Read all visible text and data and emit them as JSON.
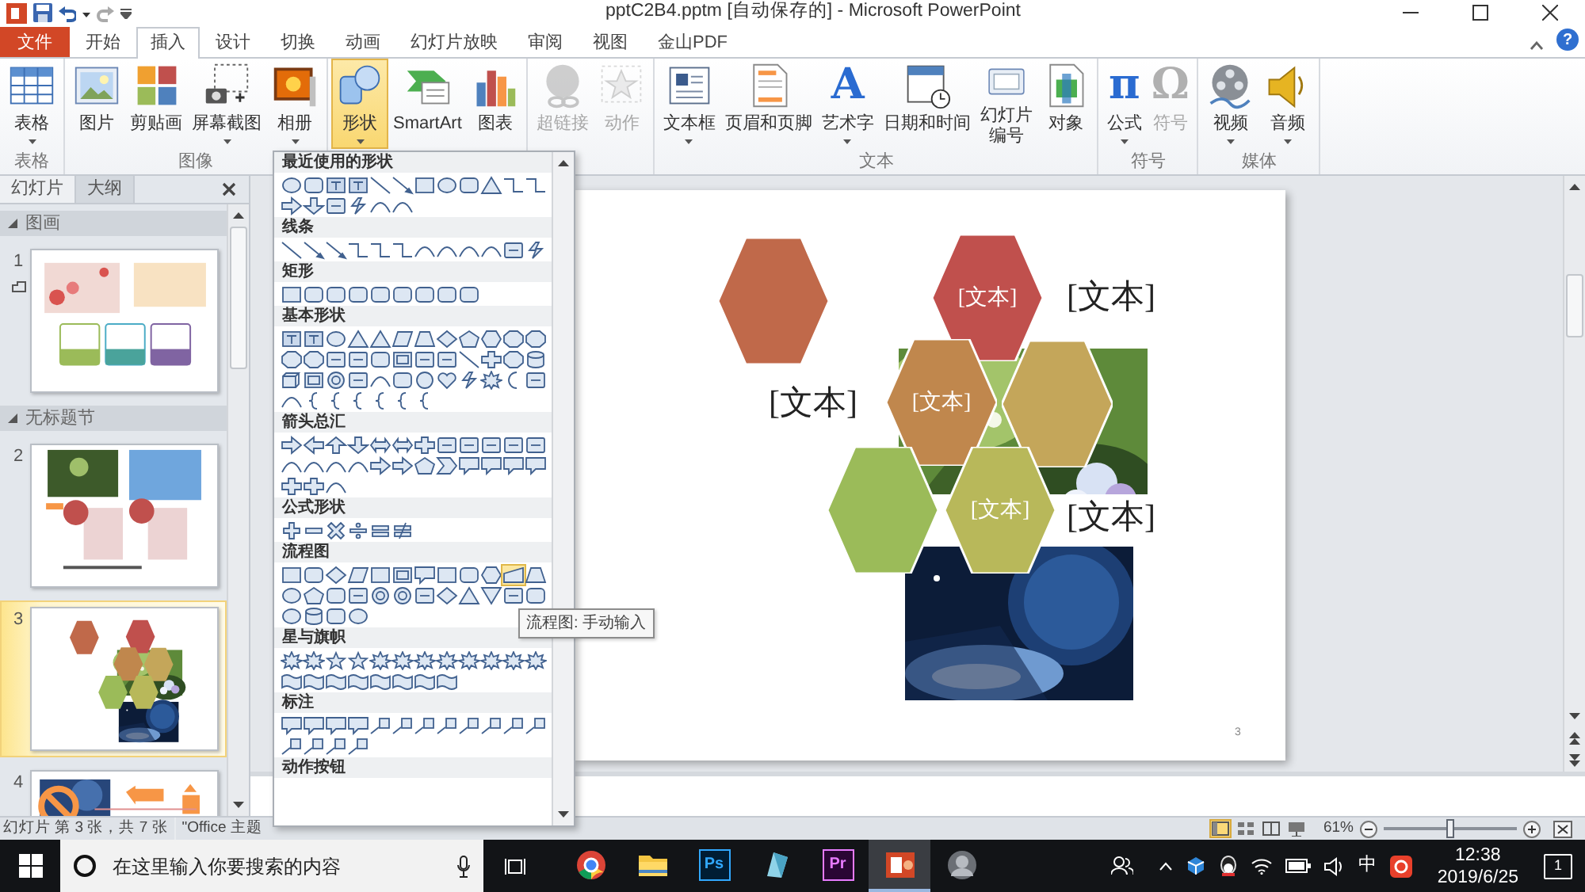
{
  "window": {
    "title": "pptC2B4.pptm [自动保存的] - Microsoft PowerPoint"
  },
  "ribbon_tabs": [
    {
      "label": "文件",
      "kind": "file",
      "selected": false
    },
    {
      "label": "开始",
      "kind": "tab",
      "selected": false
    },
    {
      "label": "插入",
      "kind": "tab",
      "selected": true
    },
    {
      "label": "设计",
      "kind": "tab",
      "selected": false
    },
    {
      "label": "切换",
      "kind": "tab",
      "selected": false
    },
    {
      "label": "动画",
      "kind": "tab",
      "selected": false
    },
    {
      "label": "幻灯片放映",
      "kind": "tab",
      "selected": false
    },
    {
      "label": "审阅",
      "kind": "tab",
      "selected": false
    },
    {
      "label": "视图",
      "kind": "tab",
      "selected": false
    },
    {
      "label": "金山PDF",
      "kind": "tab",
      "selected": false
    }
  ],
  "help": "?",
  "ribbon_groups": [
    {
      "label": "表格",
      "buttons": [
        {
          "label": "表格",
          "kind": "table",
          "dropdown": true,
          "disabled": false,
          "selected": false
        }
      ]
    },
    {
      "label": "图像",
      "buttons": [
        {
          "label": "图片",
          "kind": "picture",
          "dropdown": false,
          "disabled": false,
          "selected": false
        },
        {
          "label": "剪贴画",
          "kind": "clipart",
          "dropdown": false,
          "disabled": false,
          "selected": false
        },
        {
          "label": "屏幕截图",
          "kind": "screenshot",
          "dropdown": true,
          "disabled": false,
          "selected": false
        },
        {
          "label": "相册",
          "kind": "album",
          "dropdown": true,
          "disabled": false,
          "selected": false
        }
      ]
    },
    {
      "buttons": [
        {
          "label": "形状",
          "kind": "shapes",
          "dropdown": true,
          "disabled": false,
          "selected": true
        },
        {
          "label": "SmartArt",
          "kind": "smartart",
          "dropdown": false,
          "disabled": false,
          "selected": false
        },
        {
          "label": "图表",
          "kind": "chart",
          "dropdown": false,
          "disabled": false,
          "selected": false
        }
      ]
    },
    {
      "buttons": [
        {
          "label": "超链接",
          "kind": "hyperlink",
          "dropdown": false,
          "disabled": true,
          "selected": false
        },
        {
          "label": "动作",
          "kind": "action",
          "dropdown": false,
          "disabled": true,
          "selected": false
        }
      ]
    },
    {
      "label": "文本",
      "buttons": [
        {
          "label": "文本框",
          "kind": "textbox",
          "dropdown": true,
          "disabled": false,
          "selected": false
        },
        {
          "label": "页眉和页脚",
          "kind": "headerfooter",
          "dropdown": false,
          "disabled": false,
          "selected": false
        },
        {
          "label": "艺术字",
          "kind": "wordart",
          "glyph": "A",
          "dropdown": true,
          "disabled": false,
          "selected": false
        },
        {
          "label": "日期和时间",
          "kind": "datetime",
          "dropdown": false,
          "disabled": false,
          "selected": false
        },
        {
          "label": "幻灯片",
          "label_2": "编号",
          "kind": "slidenumber",
          "dropdown": false,
          "disabled": false,
          "selected": false
        },
        {
          "label": "对象",
          "kind": "object",
          "dropdown": false,
          "disabled": false,
          "selected": false
        }
      ]
    },
    {
      "label": "符号",
      "buttons": [
        {
          "label": "公式",
          "kind": "equation",
          "glyph": "π",
          "dropdown": true,
          "disabled": false,
          "selected": false
        },
        {
          "label": "符号",
          "kind": "symbol",
          "glyph": "Ω",
          "dropdown": false,
          "disabled": true,
          "selected": false
        }
      ]
    },
    {
      "label": "媒体",
      "buttons": [
        {
          "label": "视频",
          "kind": "video",
          "dropdown": true,
          "disabled": false,
          "selected": false
        },
        {
          "label": "音频",
          "kind": "audio",
          "dropdown": true,
          "disabled": false,
          "selected": false
        }
      ]
    }
  ],
  "shape_gallery": {
    "categories": [
      {
        "title": "最近使用的形状",
        "shapes": [
          {
            "kind": "oval"
          },
          {
            "kind": "rrect"
          },
          {
            "kind": "textbox"
          },
          {
            "kind": "textbox"
          },
          {
            "kind": "line"
          },
          {
            "kind": "arrowline"
          },
          {
            "kind": "rect"
          },
          {
            "kind": "oval"
          },
          {
            "kind": "rrect"
          },
          {
            "kind": "tri"
          },
          {
            "kind": "elbow"
          },
          {
            "kind": "elbow"
          },
          {
            "kind": "arrow"
          },
          {
            "kind": "arrowdown"
          },
          {
            "kind": "misc"
          },
          {
            "kind": "bolt"
          },
          {
            "kind": "curve"
          },
          {
            "kind": "curve"
          }
        ]
      },
      {
        "title": "线条",
        "shapes": [
          {
            "kind": "line"
          },
          {
            "kind": "arrowline"
          },
          {
            "kind": "arrowline"
          },
          {
            "kind": "elbow"
          },
          {
            "kind": "elbow"
          },
          {
            "kind": "elbow"
          },
          {
            "kind": "curve"
          },
          {
            "kind": "curve"
          },
          {
            "kind": "curve"
          },
          {
            "kind": "curve"
          },
          {
            "kind": "misc"
          },
          {
            "kind": "bolt"
          }
        ]
      },
      {
        "title": "矩形",
        "shapes": [
          {
            "kind": "rect"
          },
          {
            "kind": "rrect"
          },
          {
            "kind": "rrect"
          },
          {
            "kind": "rrect"
          },
          {
            "kind": "rrect"
          },
          {
            "kind": "rrect"
          },
          {
            "kind": "rrect"
          },
          {
            "kind": "rrect"
          },
          {
            "kind": "rrect"
          }
        ]
      },
      {
        "title": "基本形状",
        "shapes": [
          {
            "kind": "textbox"
          },
          {
            "kind": "textbox"
          },
          {
            "kind": "oval"
          },
          {
            "kind": "tri"
          },
          {
            "kind": "tri"
          },
          {
            "kind": "para"
          },
          {
            "kind": "trap"
          },
          {
            "kind": "diamond"
          },
          {
            "kind": "pent"
          },
          {
            "kind": "hex"
          },
          {
            "kind": "oct"
          },
          {
            "kind": "oct"
          },
          {
            "kind": "oct"
          },
          {
            "kind": "oct"
          },
          {
            "kind": "misc"
          },
          {
            "kind": "misc"
          },
          {
            "kind": "rrect"
          },
          {
            "kind": "frame"
          },
          {
            "kind": "misc"
          },
          {
            "kind": "misc"
          },
          {
            "kind": "line"
          },
          {
            "kind": "cross"
          },
          {
            "kind": "oct"
          },
          {
            "kind": "can"
          },
          {
            "kind": "cube"
          },
          {
            "kind": "frame"
          },
          {
            "kind": "donut"
          },
          {
            "kind": "misc"
          },
          {
            "kind": "curve"
          },
          {
            "kind": "rrect"
          },
          {
            "kind": "smile"
          },
          {
            "kind": "heart"
          },
          {
            "kind": "bolt"
          },
          {
            "kind": "starburst"
          },
          {
            "kind": "moon"
          },
          {
            "kind": "misc"
          },
          {
            "kind": "curve"
          },
          {
            "kind": "brace"
          },
          {
            "kind": "brace"
          },
          {
            "kind": "brace"
          },
          {
            "kind": "brace"
          },
          {
            "kind": "brace"
          },
          {
            "kind": "brace"
          }
        ]
      },
      {
        "title": "箭头总汇",
        "shapes": [
          {
            "kind": "arrow"
          },
          {
            "kind": "arrowleft"
          },
          {
            "kind": "arrowup"
          },
          {
            "kind": "arrowdown"
          },
          {
            "kind": "arrowlr"
          },
          {
            "kind": "arrowlr"
          },
          {
            "kind": "cross"
          },
          {
            "kind": "misc"
          },
          {
            "kind": "misc"
          },
          {
            "kind": "misc"
          },
          {
            "kind": "misc"
          },
          {
            "kind": "misc"
          },
          {
            "kind": "curve"
          },
          {
            "kind": "curve"
          },
          {
            "kind": "curve"
          },
          {
            "kind": "curve"
          },
          {
            "kind": "arrow"
          },
          {
            "kind": "arrow"
          },
          {
            "kind": "pent"
          },
          {
            "kind": "chevron"
          },
          {
            "kind": "callout"
          },
          {
            "kind": "callout"
          },
          {
            "kind": "callout"
          },
          {
            "kind": "callout"
          },
          {
            "kind": "cross"
          },
          {
            "kind": "cross"
          },
          {
            "kind": "curve"
          }
        ]
      },
      {
        "title": "公式形状",
        "shapes": [
          {
            "kind": "plus"
          },
          {
            "kind": "minus"
          },
          {
            "kind": "times"
          },
          {
            "kind": "divide"
          },
          {
            "kind": "equal"
          },
          {
            "kind": "notequal"
          }
        ]
      },
      {
        "title": "流程图",
        "shapes": [
          {
            "kind": "rect",
            "hovered": false
          },
          {
            "kind": "rrect",
            "hovered": false
          },
          {
            "kind": "diamond",
            "hovered": false
          },
          {
            "kind": "para",
            "hovered": false
          },
          {
            "kind": "rect",
            "hovered": false
          },
          {
            "kind": "frame",
            "hovered": false
          },
          {
            "kind": "callout",
            "hovered": false
          },
          {
            "kind": "rect",
            "hovered": false
          },
          {
            "kind": "rrect",
            "hovered": false
          },
          {
            "kind": "hex",
            "hovered": false
          },
          {
            "kind": "manual",
            "hovered": true
          },
          {
            "kind": "trap",
            "hovered": false
          },
          {
            "kind": "oval",
            "hovered": false
          },
          {
            "kind": "pent",
            "hovered": false
          },
          {
            "kind": "rrect",
            "hovered": false
          },
          {
            "kind": "misc",
            "hovered": false
          },
          {
            "kind": "donut",
            "hovered": false
          },
          {
            "kind": "donut",
            "hovered": false
          },
          {
            "kind": "misc",
            "hovered": false
          },
          {
            "kind": "diamond",
            "hovered": false
          },
          {
            "kind": "tri",
            "hovered": false
          },
          {
            "kind": "tridown",
            "hovered": false
          },
          {
            "kind": "misc",
            "hovered": false
          },
          {
            "kind": "rrect",
            "hovered": false
          },
          {
            "kind": "oval",
            "hovered": false
          },
          {
            "kind": "can",
            "hovered": false
          },
          {
            "kind": "rrect",
            "hovered": false
          },
          {
            "kind": "oval",
            "hovered": false
          }
        ]
      },
      {
        "title": "星与旗帜",
        "shapes": [
          {
            "kind": "starburst"
          },
          {
            "kind": "starburst"
          },
          {
            "kind": "star"
          },
          {
            "kind": "star"
          },
          {
            "kind": "starburst"
          },
          {
            "kind": "starburst"
          },
          {
            "kind": "starburst"
          },
          {
            "kind": "starburst"
          },
          {
            "kind": "starburst"
          },
          {
            "kind": "starburst"
          },
          {
            "kind": "starburst"
          },
          {
            "kind": "starburst"
          },
          {
            "kind": "banner"
          },
          {
            "kind": "banner"
          },
          {
            "kind": "banner"
          },
          {
            "kind": "banner"
          },
          {
            "kind": "banner"
          },
          {
            "kind": "banner"
          },
          {
            "kind": "banner"
          },
          {
            "kind": "banner"
          }
        ]
      },
      {
        "title": "标注",
        "shapes": [
          {
            "kind": "callout"
          },
          {
            "kind": "callout"
          },
          {
            "kind": "callout"
          },
          {
            "kind": "callout"
          },
          {
            "kind": "linecallout"
          },
          {
            "kind": "linecallout"
          },
          {
            "kind": "linecallout"
          },
          {
            "kind": "linecallout"
          },
          {
            "kind": "linecallout"
          },
          {
            "kind": "linecallout"
          },
          {
            "kind": "linecallout"
          },
          {
            "kind": "linecallout"
          },
          {
            "kind": "linecallout"
          },
          {
            "kind": "linecallout"
          },
          {
            "kind": "linecallout"
          },
          {
            "kind": "linecallout"
          }
        ]
      },
      {
        "title": "动作按钮"
      }
    ],
    "tooltip": "流程图: 手动输入"
  },
  "slides_pane": {
    "tabs": [
      {
        "label": "幻灯片",
        "selected": true
      },
      {
        "label": "大纲",
        "selected": false
      }
    ],
    "sections": [
      {
        "title": "图画",
        "expanded": true,
        "slides": [
          {
            "number": "1",
            "kind": "flowers",
            "animated": true,
            "selected": false
          }
        ]
      },
      {
        "title": "无标题节",
        "expanded": true,
        "slides": [
          {
            "number": "2",
            "kind": "photos",
            "animated": false,
            "selected": false
          },
          {
            "number": "3",
            "kind": "hexagons",
            "animated": false,
            "selected": true
          },
          {
            "number": "4",
            "kind": "arrows",
            "animated": false,
            "selected": false
          }
        ]
      }
    ]
  },
  "slide": {
    "hexagons": [
      {
        "color": "#c0694a"
      },
      {
        "color": "#c0504d",
        "text": "[文本]"
      },
      {
        "color": "#c0874d",
        "text": "[文本]"
      },
      {
        "color": "#c4a65a"
      },
      {
        "color": "#9bbb59"
      },
      {
        "color": "#b8b85a",
        "text": "[文本]"
      }
    ],
    "texts": [
      "[文本]",
      "[文本]",
      "[文本]"
    ],
    "page_number": "3"
  },
  "status_bar": {
    "slide_info": "幻灯片 第 3 张，共 7 张",
    "theme": "\"Office 主题",
    "views": [
      {
        "kind": "normal",
        "selected": true
      },
      {
        "kind": "sorter",
        "selected": false
      },
      {
        "kind": "reading",
        "selected": false
      },
      {
        "kind": "show",
        "selected": false
      }
    ],
    "zoom": "61%",
    "level": 0.5
  },
  "taskbar": {
    "search_placeholder": "在这里输入你要搜索的内容",
    "apps": [
      {
        "kind": "chrome",
        "selected": false
      },
      {
        "kind": "explorer",
        "selected": false
      },
      {
        "kind": "photoshop",
        "label": "Ps",
        "selected": false
      },
      {
        "kind": "app",
        "selected": false
      },
      {
        "kind": "premiere",
        "label": "Pr",
        "selected": false
      },
      {
        "kind": "powerpoint",
        "selected": true
      },
      {
        "kind": "avatar",
        "selected": false
      }
    ],
    "ime": "中",
    "time": "12:38",
    "date": "2019/6/25",
    "notifications": "1"
  }
}
